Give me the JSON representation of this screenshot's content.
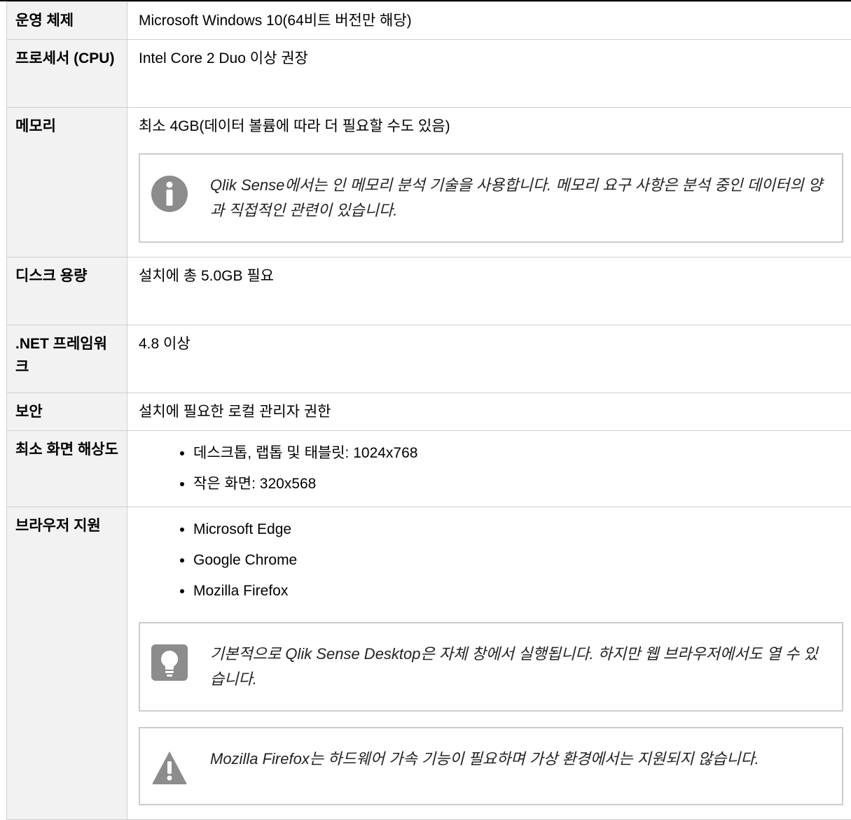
{
  "table": {
    "os": {
      "label": "운영 체제",
      "value": "Microsoft Windows 10(64비트 버전만 해당)"
    },
    "cpu": {
      "label": "프로세서 (CPU)",
      "value": "Intel Core 2 Duo 이상 권장"
    },
    "memory": {
      "label": "메모리",
      "value": "최소 4GB(데이터 볼륨에 따라 더 필요할 수도 있음)",
      "note": {
        "icon": "info-icon",
        "text": "Qlik Sense에서는 인 메모리 분석 기술을 사용합니다. 메모리 요구 사항은 분석 중인 데이터의 양과 직접적인 관련이 있습니다."
      }
    },
    "disk": {
      "label": "디스크 용량",
      "value": "설치에 총 5.0GB 필요"
    },
    "dotnet": {
      "label": ".NET 프레임워크",
      "value": "4.8 이상"
    },
    "security": {
      "label": "보안",
      "value": "설치에 필요한 로컬 관리자 권한"
    },
    "resolution": {
      "label": "최소 화면 해상도",
      "items": [
        "데스크톱, 랩톱 및 태블릿: 1024x768",
        "작은 화면: 320x568"
      ]
    },
    "browser": {
      "label": "브라우저 지원",
      "items": [
        "Microsoft Edge",
        "Google Chrome",
        "Mozilla Firefox"
      ],
      "tip": {
        "icon": "lightbulb-icon",
        "text": "기본적으로 Qlik Sense Desktop은 자체 창에서 실행됩니다. 하지만 웹 브라우저에서도 열 수 있습니다."
      },
      "warning": {
        "icon": "warning-icon",
        "text": "Mozilla Firefox는 하드웨어 가속 기능이 필요하며 가상 환경에서는 지원되지 않습니다."
      }
    }
  }
}
